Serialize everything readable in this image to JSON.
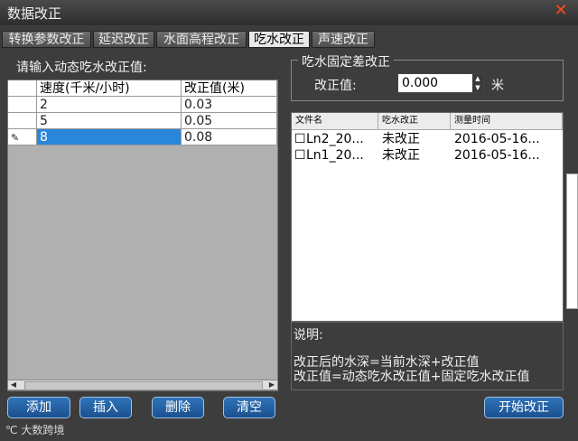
{
  "window": {
    "title": "数据改正",
    "close_icon": "close-icon"
  },
  "tabs": [
    {
      "label": "转换参数改正",
      "active": false
    },
    {
      "label": "延迟改正",
      "active": false
    },
    {
      "label": "水面高程改正",
      "active": false
    },
    {
      "label": "吃水改正",
      "active": true
    },
    {
      "label": "声速改正",
      "active": false
    }
  ],
  "left": {
    "prompt": "请输入动态吃水改正值:",
    "columns": [
      "速度(千米/小时)",
      "改正值(米)"
    ],
    "rows": [
      {
        "speed": "2",
        "value": "0.03"
      },
      {
        "speed": "5",
        "value": "0.05"
      },
      {
        "speed": "8",
        "value": "0.08",
        "editing": true
      }
    ]
  },
  "fixed": {
    "group_title": "吃水固定差改正",
    "label": "改正值:",
    "value": "0.000",
    "unit": "米"
  },
  "files": {
    "columns": [
      "文件名",
      "吃水改正",
      "测量时间"
    ],
    "rows": [
      {
        "name": "Ln2_20...",
        "status": "未改正",
        "time": "2016-05-16..."
      },
      {
        "name": "Ln1_20...",
        "status": "未改正",
        "time": "2016-05-16..."
      }
    ]
  },
  "note": {
    "title": "说明:",
    "line1": "改正后的水深=当前水深+改正值",
    "line2": "改正值=动态吃水改正值+固定吃水改正值"
  },
  "buttons": {
    "add": "添加",
    "insert": "插入",
    "delete": "删除",
    "clear": "清空",
    "start": "开始改正"
  },
  "footer": {
    "logo_text": "大数跨境"
  },
  "colors": {
    "accent": "#2a86d8",
    "button": "#1f5e9f",
    "close": "#ff4a1a"
  }
}
